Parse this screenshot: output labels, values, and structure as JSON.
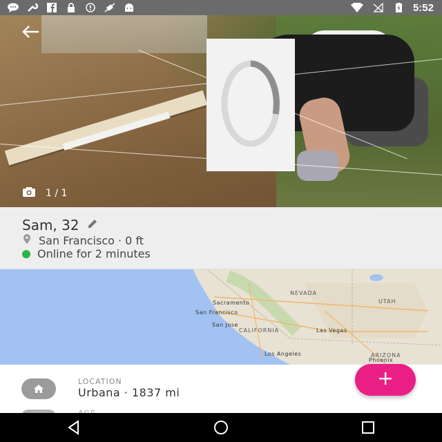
{
  "status_bar": {
    "time": "5:52",
    "left_icons": [
      "chat-icon",
      "wrench-icon",
      "facebook-icon",
      "lock-icon",
      "alert-icon",
      "no-satellite-icon",
      "android-icon"
    ],
    "right_icons": [
      "wifi-icon",
      "no-signal-icon",
      "battery-charging-icon"
    ]
  },
  "photo": {
    "counter": "1 / 1",
    "back_icon": "arrow-back-icon",
    "loading_icon": "spinner-icon",
    "camera_icon": "camera-icon"
  },
  "profile": {
    "name": "Sam, 32",
    "edit_icon": "pencil-icon",
    "location": "San Francisco · 0 ft",
    "status": "Online for 2 minutes",
    "status_color": "#2db34a"
  },
  "map": {
    "labels": [
      "Sacramento",
      "San Francisco",
      "San Jose",
      "NEVADA",
      "UTAH",
      "CALIFORNIA",
      "Las Vegas",
      "Los Angeles",
      "ARIZONA",
      "Phoenix"
    ]
  },
  "info": {
    "icon": "home-icon",
    "label": "LOCATION",
    "value": "Urbana · 1837 mi",
    "next_label": "AGE"
  },
  "fab": {
    "icon": "plus-icon",
    "color": "#ea1f86"
  },
  "navbar": {
    "icons": [
      "back-triangle-icon",
      "home-circle-icon",
      "recents-square-icon"
    ]
  }
}
